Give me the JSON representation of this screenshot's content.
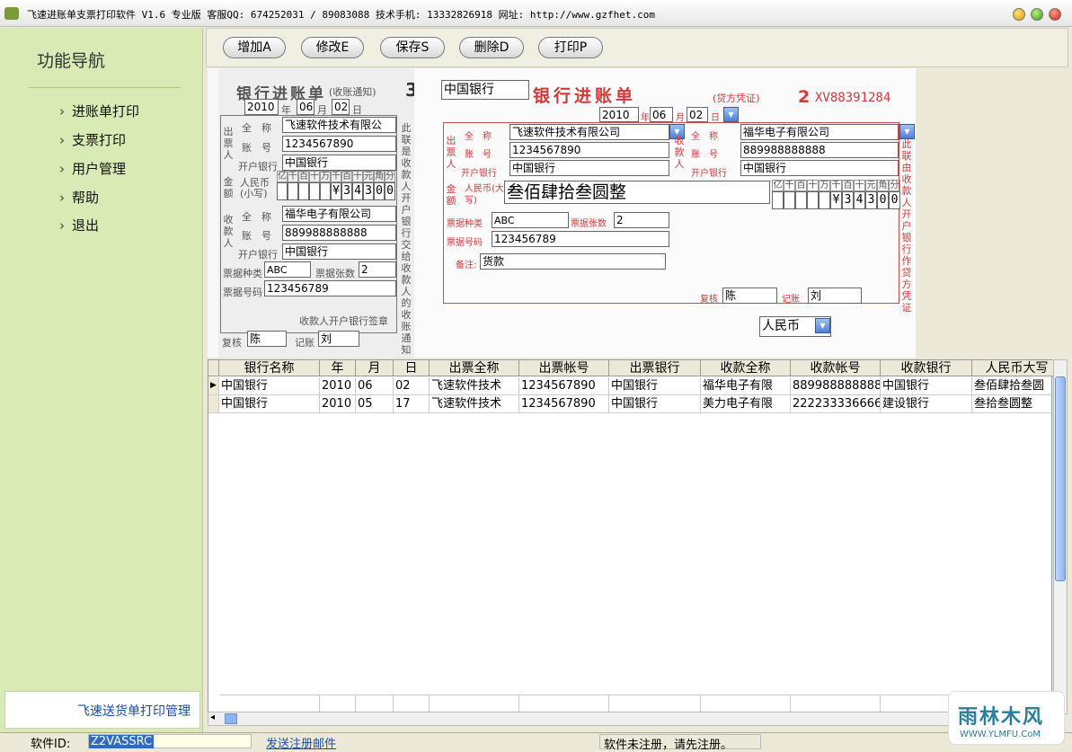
{
  "window": {
    "title": "飞速进账单支票打印软件 V1.6 专业版 客服QQ: 674252031 / 89083088 技术手机: 13332826918 网址: http://www.gzfhet.com"
  },
  "sidebar": {
    "title": "功能导航",
    "items": [
      {
        "label": "进账单打印"
      },
      {
        "label": "支票打印"
      },
      {
        "label": "用户管理"
      },
      {
        "label": "帮助"
      },
      {
        "label": "退出"
      }
    ],
    "marquee": "飞速送货单打印管理"
  },
  "toolbar": {
    "add": "增加A",
    "edit": "修改E",
    "save": "保存S",
    "delete": "删除D",
    "print": "打印P"
  },
  "receipt": {
    "title": "银行进账单",
    "subtitle": "(收账通知)",
    "number": "3",
    "year": "2010",
    "month": "06",
    "day": "02",
    "year_label": "年",
    "month_label": "月",
    "day_label": "日",
    "payer_label": "出票人",
    "payee_label": "收款人",
    "amount_label": "金额",
    "name_label": "全　称",
    "account_label": "账　号",
    "bank_label": "开户银行",
    "payer_name": "飞速软件技术有限公",
    "payer_account": "1234567890",
    "payer_bank": "中国银行",
    "amount_small_label": "人民币(小写)",
    "digit_units": [
      "亿",
      "千",
      "百",
      "十",
      "万",
      "千",
      "百",
      "十",
      "元",
      "角",
      "分"
    ],
    "amount_digits": [
      "",
      "",
      "",
      "",
      "",
      "¥",
      "3",
      "4",
      "3",
      "0",
      "0"
    ],
    "payee_name": "福华电子有限公司",
    "payee_account": "889988888888",
    "payee_bank": "中国银行",
    "ticket_type_label": "票据种类",
    "ticket_type": "ABC",
    "ticket_count_label": "票据张数",
    "ticket_count": "2",
    "ticket_no_label": "票据号码",
    "ticket_no": "123456789",
    "sign_label": "收款人开户银行签章",
    "side_note": "此联是收款人开户银行交给收款人的收账通知",
    "reviewer_label": "复核",
    "reviewer": "陈",
    "clerk_label": "记账",
    "clerk": "刘"
  },
  "voucher": {
    "bank": "中国银行",
    "title": "银行进账单",
    "subtitle": "(贷方凭证)",
    "number": "2",
    "serial": "XV88391284",
    "year": "2010",
    "month": "06",
    "day": "02",
    "year_label": "年",
    "month_label": "月",
    "day_label": "日",
    "payer_label": "出票人",
    "payee_label": "收款人",
    "amount_label": "金额",
    "name_label": "全　称",
    "account_label": "账　号",
    "bank_label": "开户银行",
    "payer_name": "飞速软件技术有限公司",
    "payer_account": "1234567890",
    "payer_bank": "中国银行",
    "payee_name": "福华电子有限公司",
    "payee_account": "889988888888",
    "payee_bank": "中国银行",
    "amount_big_label": "人民币(大写)",
    "amount_big": "叁佰肆拾叁圆整",
    "digit_units": [
      "亿",
      "千",
      "百",
      "十",
      "万",
      "千",
      "百",
      "十",
      "元",
      "角",
      "分"
    ],
    "amount_digits": [
      "",
      "",
      "",
      "",
      "",
      "¥",
      "3",
      "4",
      "3",
      "0",
      "0"
    ],
    "ticket_type_label": "票据种类",
    "ticket_type": "ABC",
    "ticket_count_label": "票据张数",
    "ticket_count": "2",
    "ticket_no_label": "票据号码",
    "ticket_no": "123456789",
    "remark_label": "备注:",
    "remark": "货款",
    "side_note": "此联由收款人开户银行作贷方凭证",
    "reviewer_label": "复核",
    "reviewer": "陈",
    "clerk_label": "记账",
    "clerk": "刘",
    "currency": "人民币"
  },
  "table": {
    "columns": [
      "银行名称",
      "年",
      "月",
      "日",
      "出票全称",
      "出票帐号",
      "出票银行",
      "收款全称",
      "收款帐号",
      "收款银行",
      "人民币大写"
    ],
    "rows": [
      [
        "中国银行",
        "2010",
        "06",
        "02",
        "飞速软件技术",
        "1234567890",
        "中国银行",
        "福华电子有限",
        "889988888888",
        "中国银行",
        "叁佰肆拾叁圆"
      ],
      [
        "中国银行",
        "2010",
        "05",
        "17",
        "飞速软件技术",
        "1234567890",
        "中国银行",
        "美力电子有限",
        "222233336666",
        "建设银行",
        "叁拾叁圆整"
      ]
    ]
  },
  "status": {
    "id_label": "软件ID:",
    "id_value": "Z2VASSRC",
    "send_mail": "发送注册邮件",
    "message": "软件未注册，请先注册。"
  },
  "watermark": {
    "text": "雨林木风",
    "url": "WWW.YLMFU.CoM"
  }
}
